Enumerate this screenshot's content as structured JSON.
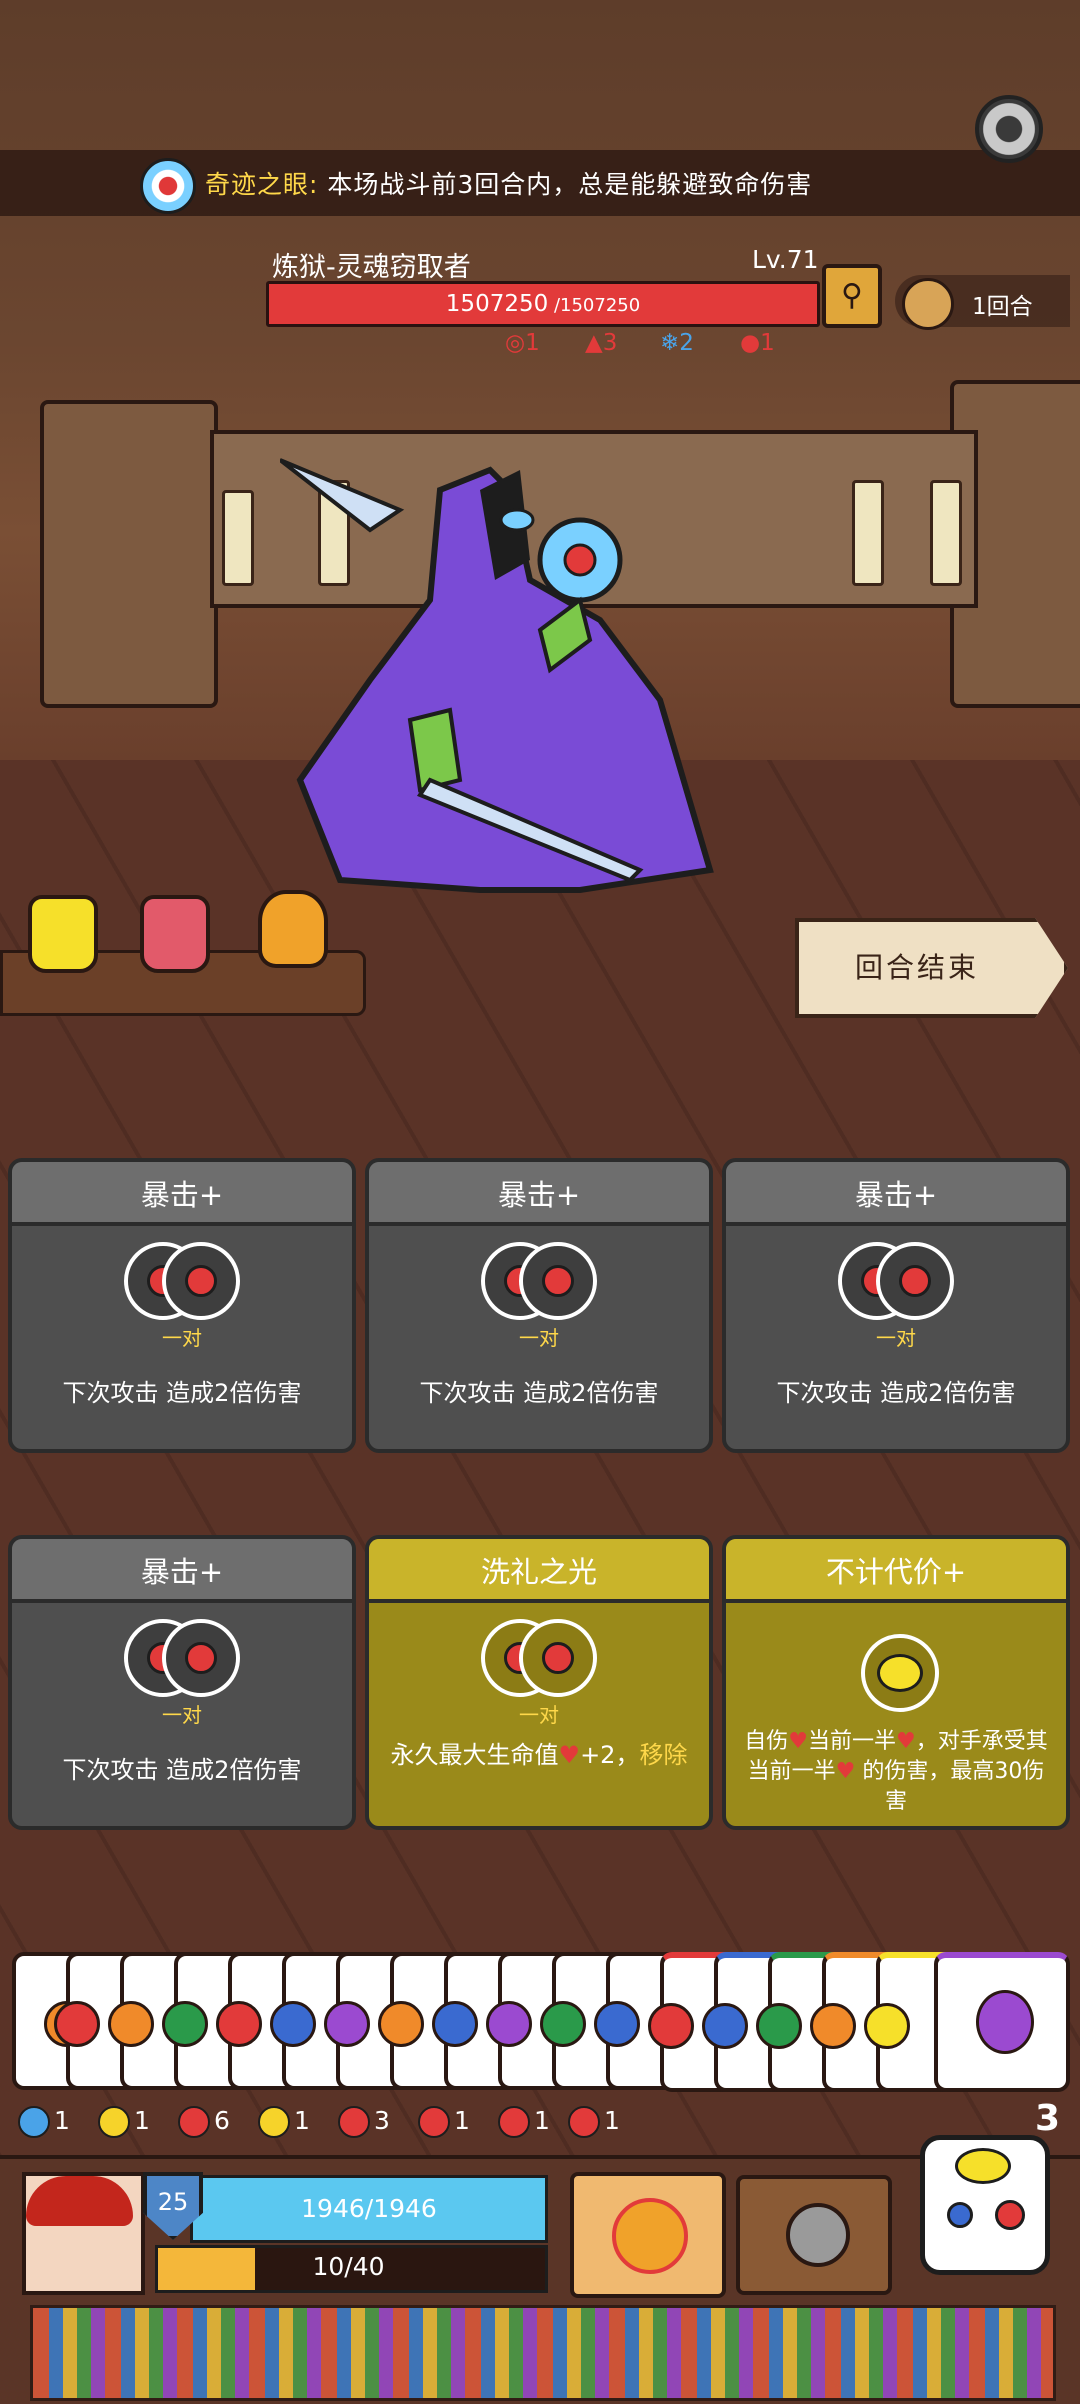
{
  "header": {
    "buff_title": "奇迹之眼:",
    "buff_text": "本场战斗前3回合内，总是能躲避致命伤害"
  },
  "boss": {
    "name": "炼狱-灵魂窃取者",
    "level": "Lv.71",
    "hp_current": "1507250",
    "hp_max": " /1507250",
    "status": [
      {
        "icon": "spiral-icon",
        "value": "1",
        "color": "#e23a3a"
      },
      {
        "icon": "fire-icon",
        "value": "3",
        "color": "#e23a3a"
      },
      {
        "icon": "snowflake-icon",
        "value": "2",
        "color": "#4aa3e8"
      },
      {
        "icon": "blood-drop-icon",
        "value": "1",
        "color": "#e23a3a"
      }
    ]
  },
  "round": {
    "label": "1回合"
  },
  "end_turn": {
    "label": "回合结束"
  },
  "cards": [
    {
      "title": "暴击+",
      "pair": "一对",
      "desc": "下次攻击 造成2倍伤害"
    },
    {
      "title": "暴击+",
      "pair": "一对",
      "desc": "下次攻击 造成2倍伤害"
    },
    {
      "title": "暴击+",
      "pair": "一对",
      "desc": "下次攻击 造成2倍伤害"
    },
    {
      "title": "暴击+",
      "pair": "一对",
      "desc": "下次攻击 造成2倍伤害"
    },
    {
      "title": "洗礼之光",
      "pair": "一对",
      "desc_a": "永久最大生命值",
      "desc_b": "+2，",
      "desc_c": "移除"
    },
    {
      "title": "不计代价+",
      "desc_a": "自伤",
      "desc_b": "当前一半",
      "desc_c": "，对手承受其当前一半",
      "desc_d": " 的伤害，最高30伤害"
    }
  ],
  "player_stats": [
    {
      "icon": "target-icon",
      "value": "1",
      "color": "#4aa3e8"
    },
    {
      "icon": "lightning-icon",
      "value": "1",
      "color": "#f6d32a"
    },
    {
      "icon": "claw-icon",
      "value": "6",
      "color": "#e23a3a"
    },
    {
      "icon": "shield-icon",
      "value": "1",
      "color": "#f6d32a"
    },
    {
      "icon": "heart-shield-icon",
      "value": "3",
      "color": "#e23a3a"
    },
    {
      "icon": "crit-target-icon",
      "value": "1",
      "color": "#e23a3a"
    },
    {
      "icon": "broken-shield-icon",
      "value": "1",
      "color": "#e23a3a"
    },
    {
      "icon": "spiral-icon",
      "value": "1",
      "color": "#e23a3a"
    }
  ],
  "dice_count": "3",
  "player": {
    "level": "25",
    "hp": "1946/1946",
    "xp_text": "10/40",
    "xp_fraction": 0.25
  }
}
